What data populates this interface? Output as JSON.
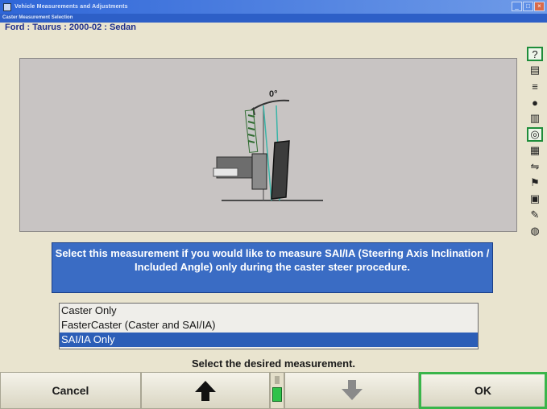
{
  "window": {
    "title": "Vehicle Measurements and Adjustments",
    "subtitle": "Caster Measurement Selection"
  },
  "vehicle": "Ford : Taurus : 2000-02 : Sedan",
  "illustration": {
    "angle_label": "0°"
  },
  "info_text": "Select this measurement if you would like to measure SAI/IA (Steering Axis Inclination / Included Angle) only during the caster steer procedure.",
  "options": [
    {
      "label": "Caster Only",
      "selected": false
    },
    {
      "label": "FasterCaster (Caster and SAI/IA)",
      "selected": false
    },
    {
      "label": "SAI/IA Only",
      "selected": true
    }
  ],
  "prompt": "Select the desired measurement.",
  "buttons": {
    "cancel": "Cancel",
    "ok": "OK"
  },
  "toolbar_icons": [
    "help-icon",
    "ruler-icon",
    "spec-icon",
    "wheel-icon",
    "gauge-icon",
    "target-icon",
    "alignment-icon",
    "adjust-icon",
    "flag-icon",
    "print-icon",
    "tool-icon",
    "globe-icon"
  ],
  "colors": {
    "accent_blue": "#3a6cc4",
    "ok_border": "#39b54a"
  }
}
